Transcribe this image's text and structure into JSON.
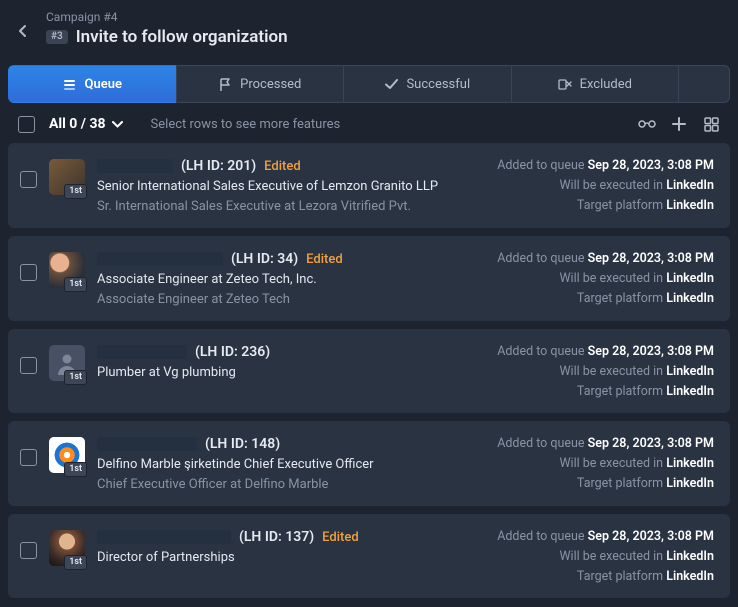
{
  "header": {
    "breadcrumb": "Campaign #4",
    "badge": "#3",
    "title": "Invite to follow organization"
  },
  "tabs": {
    "queue": "Queue",
    "processed": "Processed",
    "successful": "Successful",
    "excluded": "Excluded"
  },
  "toolbar": {
    "count": "All 0 / 38",
    "hint": "Select rows to see more features"
  },
  "meta_labels": {
    "added": "Added to queue",
    "exec": "Will be executed in",
    "target": "Target platform"
  },
  "rows": [
    {
      "name_width": 76,
      "lh_id": "(LH ID: 201)",
      "edited": "Edited",
      "avatar": "av1",
      "conn": "1st",
      "job1": "Senior International Sales Executive of Lemzon Granito LLP",
      "job2": "Sr. International Sales Executive at Lezora Vitrified Pvt.",
      "added_at": "Sep 28, 2023, 3:08 PM",
      "exec_in": "LinkedIn",
      "target": "LinkedIn"
    },
    {
      "name_width": 126,
      "lh_id": "(LH ID: 34)",
      "edited": "Edited",
      "avatar": "av2",
      "conn": "1st",
      "job1": "Associate Engineer at Zeteo Tech, Inc.",
      "job2": "Associate Engineer at Zeteo Tech",
      "added_at": "Sep 28, 2023, 3:08 PM",
      "exec_in": "LinkedIn",
      "target": "LinkedIn"
    },
    {
      "name_width": 90,
      "lh_id": "(LH ID: 236)",
      "edited": "",
      "avatar": "placeholder",
      "conn": "1st",
      "job1": "Plumber at Vg plumbing",
      "job2": "",
      "added_at": "Sep 28, 2023, 3:08 PM",
      "exec_in": "LinkedIn",
      "target": "LinkedIn"
    },
    {
      "name_width": 100,
      "lh_id": "(LH ID: 148)",
      "edited": "",
      "avatar": "av4",
      "conn": "1st",
      "job1": "Delfino Marble şirketinde Chief Executive Officer",
      "job2": "Chief Executive Officer at Delfino Marble",
      "added_at": "Sep 28, 2023, 3:08 PM",
      "exec_in": "LinkedIn",
      "target": "LinkedIn"
    },
    {
      "name_width": 134,
      "lh_id": "(LH ID: 137)",
      "edited": "Edited",
      "avatar": "av5",
      "conn": "1st",
      "job1": "Director of Partnerships",
      "job2": "",
      "added_at": "Sep 28, 2023, 3:08 PM",
      "exec_in": "LinkedIn",
      "target": "LinkedIn"
    }
  ]
}
